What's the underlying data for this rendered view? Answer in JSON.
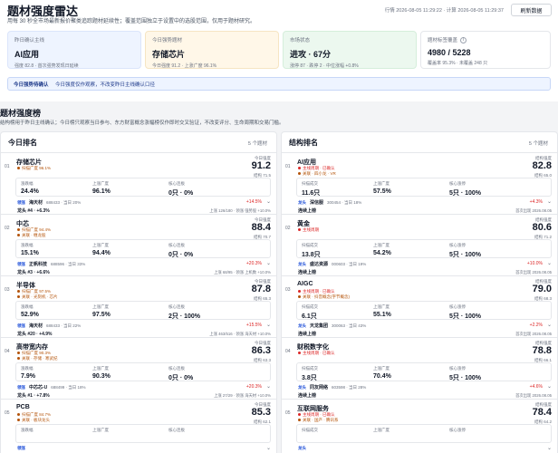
{
  "header": {
    "title": "题材强度雷达",
    "subtitle": "用每 30 秒全市场最新报价聚类追踪题材延续性；覆盖范围独立于设置中的选股范围，仅用于题材研究。",
    "times": "行情 2026-08-05 11:29:22 · 计算 2026-08-05 11:29:37",
    "refresh_label": "刷新数据"
  },
  "cards": [
    {
      "label": "昨日确认主线",
      "value": "AI应用",
      "sub": "强度 82.8 · 首次强势发现日延续"
    },
    {
      "label": "今日强势题材",
      "value": "存储芯片",
      "sub": "今日强度 91.2 · 上涨广度 96.1%"
    },
    {
      "label": "市场状态",
      "value": "进攻 · 67分",
      "sub": "涨停 87 · 跌停 2 · 中位涨幅 +0.8%"
    },
    {
      "label": "题材标签覆盖",
      "value": "4980 / 5228",
      "sub": "覆盖率 95.3% · 未覆盖 248 只",
      "icon": "info-icon"
    }
  ],
  "alert": {
    "strong": "今日强势待确认",
    "text": "今日强度仅作观察，不改变昨日主线确认口径"
  },
  "section": {
    "title": "题材强度榜",
    "subtitle": "结构榜用于昨日主线确认；今日榜只观察当日参与、东方财富概念涨幅榜仅作即时交叉验证，不改变评分、生命周期和交易门槛。"
  },
  "labels": {
    "score": "今日强度",
    "score_r": "结构强度",
    "rise": "涨跌幅",
    "breadth": "上涨广度",
    "core": "核心连板",
    "limit": "核心涨停",
    "turnover": "扫描成交",
    "lead_tag": "领涨",
    "lead_tag_r": "龙头"
  },
  "left": {
    "title": "今日排名",
    "count": "5 个题材",
    "items": [
      {
        "rank": "01",
        "name": "存储芯片",
        "s1": "扫描广度 96.1%",
        "s2": "",
        "score": "91.2",
        "score_sub": "结构 71.5",
        "rise": "24.4%",
        "breadth": "96.1%",
        "core": "0只 · 0%",
        "lead_name": "海天材",
        "lead_code": "688433 · 当日 20%",
        "chg": "+14.5%",
        "foot_left": "龙头 #4 · +6.3%",
        "foot_right": "上涨 126/180 · 领涨 强势股 +10.0%"
      },
      {
        "rank": "02",
        "name": "中芯",
        "s1": "扫描广度 94.4%",
        "s2": "关联 · 缠龙股",
        "score": "88.4",
        "score_sub": "结构 70.7",
        "rise": "15.1%",
        "breadth": "94.4%",
        "core": "0只 · 0%",
        "lead_name": "正帆科技",
        "lead_code": "688596 · 当日 33%",
        "chg": "+20.3%",
        "foot_left": "龙头 #3 · +6.6%",
        "foot_right": "上涨 68/95 · 领涨 上机数 +10.0%"
      },
      {
        "rank": "03",
        "name": "半导体",
        "s1": "扫描广度 97.5%",
        "s2": "关联 · 光刻机 · 芯片",
        "score": "87.8",
        "score_sub": "结构 65.3",
        "rise": "52.9%",
        "breadth": "97.5%",
        "core": "2只 · 100%",
        "lead_name": "海天材",
        "lead_code": "688433 · 当日 22%",
        "chg": "+15.5%",
        "foot_left": "龙头 #20 · +4.9%",
        "foot_right": "上涨 463/516 · 领涨 海天材 +10.0%"
      },
      {
        "rank": "04",
        "name": "高带宽内存",
        "s1": "扫描广度 90.3%",
        "s2": "关联 · 存储 · 寒武纪",
        "score": "86.3",
        "score_sub": "结构 63.3",
        "rise": "7.9%",
        "breadth": "90.3%",
        "core": "0只 · 0%",
        "lead_name": "中芯芯-U",
        "lead_code": "688499 · 当日 18%",
        "chg": "+20.3%",
        "foot_left": "龙头 #1 · +7.8%",
        "foot_right": "上涨 27/29 · 领涨 海天材 +10.0%"
      },
      {
        "rank": "05",
        "name": "PCB",
        "s1": "扫描广度 84.7%",
        "s2": "关联 · 板块龙头",
        "score": "85.3",
        "score_sub": "结构 62.1",
        "rise": "",
        "breadth": "",
        "core": "",
        "lead_name": "",
        "lead_code": "",
        "chg": "",
        "foot_left": "",
        "foot_right": ""
      }
    ]
  },
  "right": {
    "title": "结构排名",
    "count": "5 个题材",
    "items": [
      {
        "rank": "01",
        "name": "AI应用",
        "s1": "主线周期 · 已确认",
        "s2": "关联 · 四小龙 · VR",
        "score": "82.8",
        "score_sub": "结构 65.0",
        "rise": "11.6只",
        "breadth": "57.5%",
        "core": "5只 · 100%",
        "lead_name": "深信服",
        "lead_code": "300454 · 当日 18%",
        "chg": "+4.3%",
        "foot_left": "连续上榜",
        "foot_right": "首次出现 2026.08.05"
      },
      {
        "rank": "02",
        "name": "黄金",
        "s1": "主线周期",
        "s2": "",
        "score": "80.6",
        "score_sub": "结构 71.2",
        "rise": "13.8只",
        "breadth": "54.2%",
        "core": "5只 · 100%",
        "lead_name": "盛达资源",
        "lead_code": "000603 · 当日 19%",
        "chg": "+10.0%",
        "foot_left": "连续上榜",
        "foot_right": "首次出现 2026.08.05"
      },
      {
        "rank": "03",
        "name": "AIGC",
        "s1": "主线周期 · 已确认",
        "s2": "关联 · 抖音概念(字节概念)",
        "score": "79.0",
        "score_sub": "结构 68.3",
        "rise": "6.1只",
        "breadth": "55.1%",
        "core": "5只 · 100%",
        "lead_name": "天龙集团",
        "lead_code": "300063 · 当日 43%",
        "chg": "+2.2%",
        "foot_left": "连续上榜",
        "foot_right": "首次出现 2026.08.05"
      },
      {
        "rank": "04",
        "name": "财税数字化",
        "s1": "主线周期 · 已确认",
        "s2": "",
        "score": "78.8",
        "score_sub": "结构 66.1",
        "rise": "3.8只",
        "breadth": "70.4%",
        "core": "5只 · 100%",
        "lead_name": "同友网络",
        "lead_code": "603598 · 当日 28%",
        "chg": "+4.6%",
        "foot_left": "连续上榜",
        "foot_right": "首次出现 2026.08.05"
      },
      {
        "rank": "05",
        "name": "互联网服务",
        "s1": "主线周期 · 已确认",
        "s2": "关联 · 国产 · 腾讯系",
        "score": "78.4",
        "score_sub": "结构 64.2",
        "rise": "",
        "breadth": "",
        "core": "",
        "lead_name": "",
        "lead_code": "",
        "chg": "",
        "foot_left": "",
        "foot_right": ""
      }
    ]
  }
}
